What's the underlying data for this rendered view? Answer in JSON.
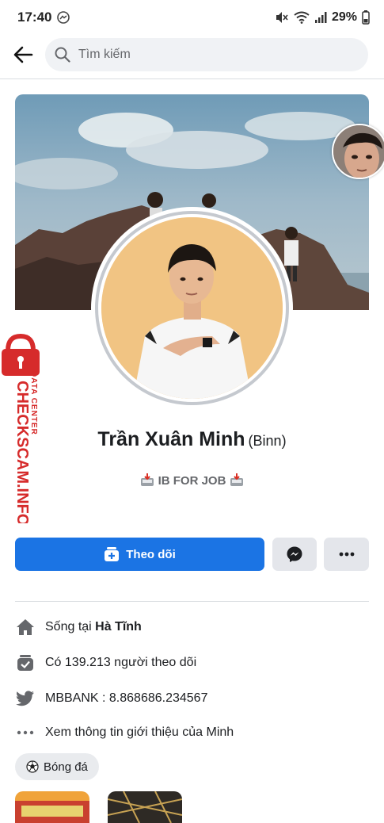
{
  "status_bar": {
    "time": "17:40",
    "battery": "29%"
  },
  "search": {
    "placeholder": "Tìm kiếm"
  },
  "profile": {
    "name": "Trần Xuân Minh",
    "alternate_name": "(Binn)",
    "bio": "IB FOR JOB"
  },
  "actions": {
    "follow_label": "Theo dõi"
  },
  "watermark": {
    "brand": "CHECKSCAM.INFO",
    "sub": "DATA CENTER"
  },
  "intro": {
    "lives_prefix": "Sống tại ",
    "lives_place": "Hà Tĩnh",
    "followers_text": "Có 139.213 người theo dõi",
    "twitter_text": "MBBANK : 8.868686.234567",
    "see_about_text": "Xem thông tin giới thiệu của Minh"
  },
  "hobbies": [
    {
      "label": "Bóng đá"
    }
  ],
  "colors": {
    "primary": "#1b74e4",
    "secondary_bg": "#e4e6eb",
    "icon_gray": "#65676b",
    "watermark_red": "#d62b2b"
  }
}
